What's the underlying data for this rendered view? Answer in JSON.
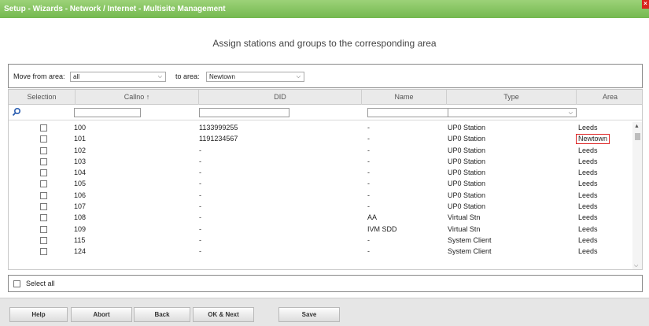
{
  "window": {
    "title": "Setup - Wizards - Network / Internet - Multisite Management",
    "close_glyph": "×"
  },
  "page": {
    "heading": "Assign stations and groups to the corresponding area"
  },
  "move": {
    "from_label": "Move from area:",
    "from_value": "all",
    "to_label": "to area:",
    "to_value": "Newtown"
  },
  "table": {
    "columns": [
      "Selection",
      "Callno ↑",
      "DID",
      "Name",
      "Type",
      "Area"
    ],
    "rows": [
      {
        "callno": "100",
        "did": "1133999255",
        "name": "-",
        "type": "UP0 Station",
        "area": "Leeds"
      },
      {
        "callno": "101",
        "did": "1191234567",
        "name": "-",
        "type": "UP0 Station",
        "area": "Newtown"
      },
      {
        "callno": "102",
        "did": "-",
        "name": "-",
        "type": "UP0 Station",
        "area": "Leeds"
      },
      {
        "callno": "103",
        "did": "-",
        "name": "-",
        "type": "UP0 Station",
        "area": "Leeds"
      },
      {
        "callno": "104",
        "did": "-",
        "name": "-",
        "type": "UP0 Station",
        "area": "Leeds"
      },
      {
        "callno": "105",
        "did": "-",
        "name": "-",
        "type": "UP0 Station",
        "area": "Leeds"
      },
      {
        "callno": "106",
        "did": "-",
        "name": "-",
        "type": "UP0 Station",
        "area": "Leeds"
      },
      {
        "callno": "107",
        "did": "-",
        "name": "-",
        "type": "UP0 Station",
        "area": "Leeds"
      },
      {
        "callno": "108",
        "did": "-",
        "name": "AA",
        "type": "Virtual Stn",
        "area": "Leeds"
      },
      {
        "callno": "109",
        "did": "-",
        "name": "IVM SDD",
        "type": "Virtual Stn",
        "area": "Leeds"
      },
      {
        "callno": "115",
        "did": "-",
        "name": "-",
        "type": "System Client",
        "area": "Leeds"
      },
      {
        "callno": "124",
        "did": "-",
        "name": "-",
        "type": "System Client",
        "area": "Leeds"
      }
    ]
  },
  "select_all_label": "Select all",
  "buttons": {
    "help": "Help",
    "abort": "Abort",
    "back": "Back",
    "ok_next": "OK & Next",
    "save": "Save"
  },
  "colors": {
    "titlebar": "#7fc05a",
    "highlight": "#dd2222"
  }
}
